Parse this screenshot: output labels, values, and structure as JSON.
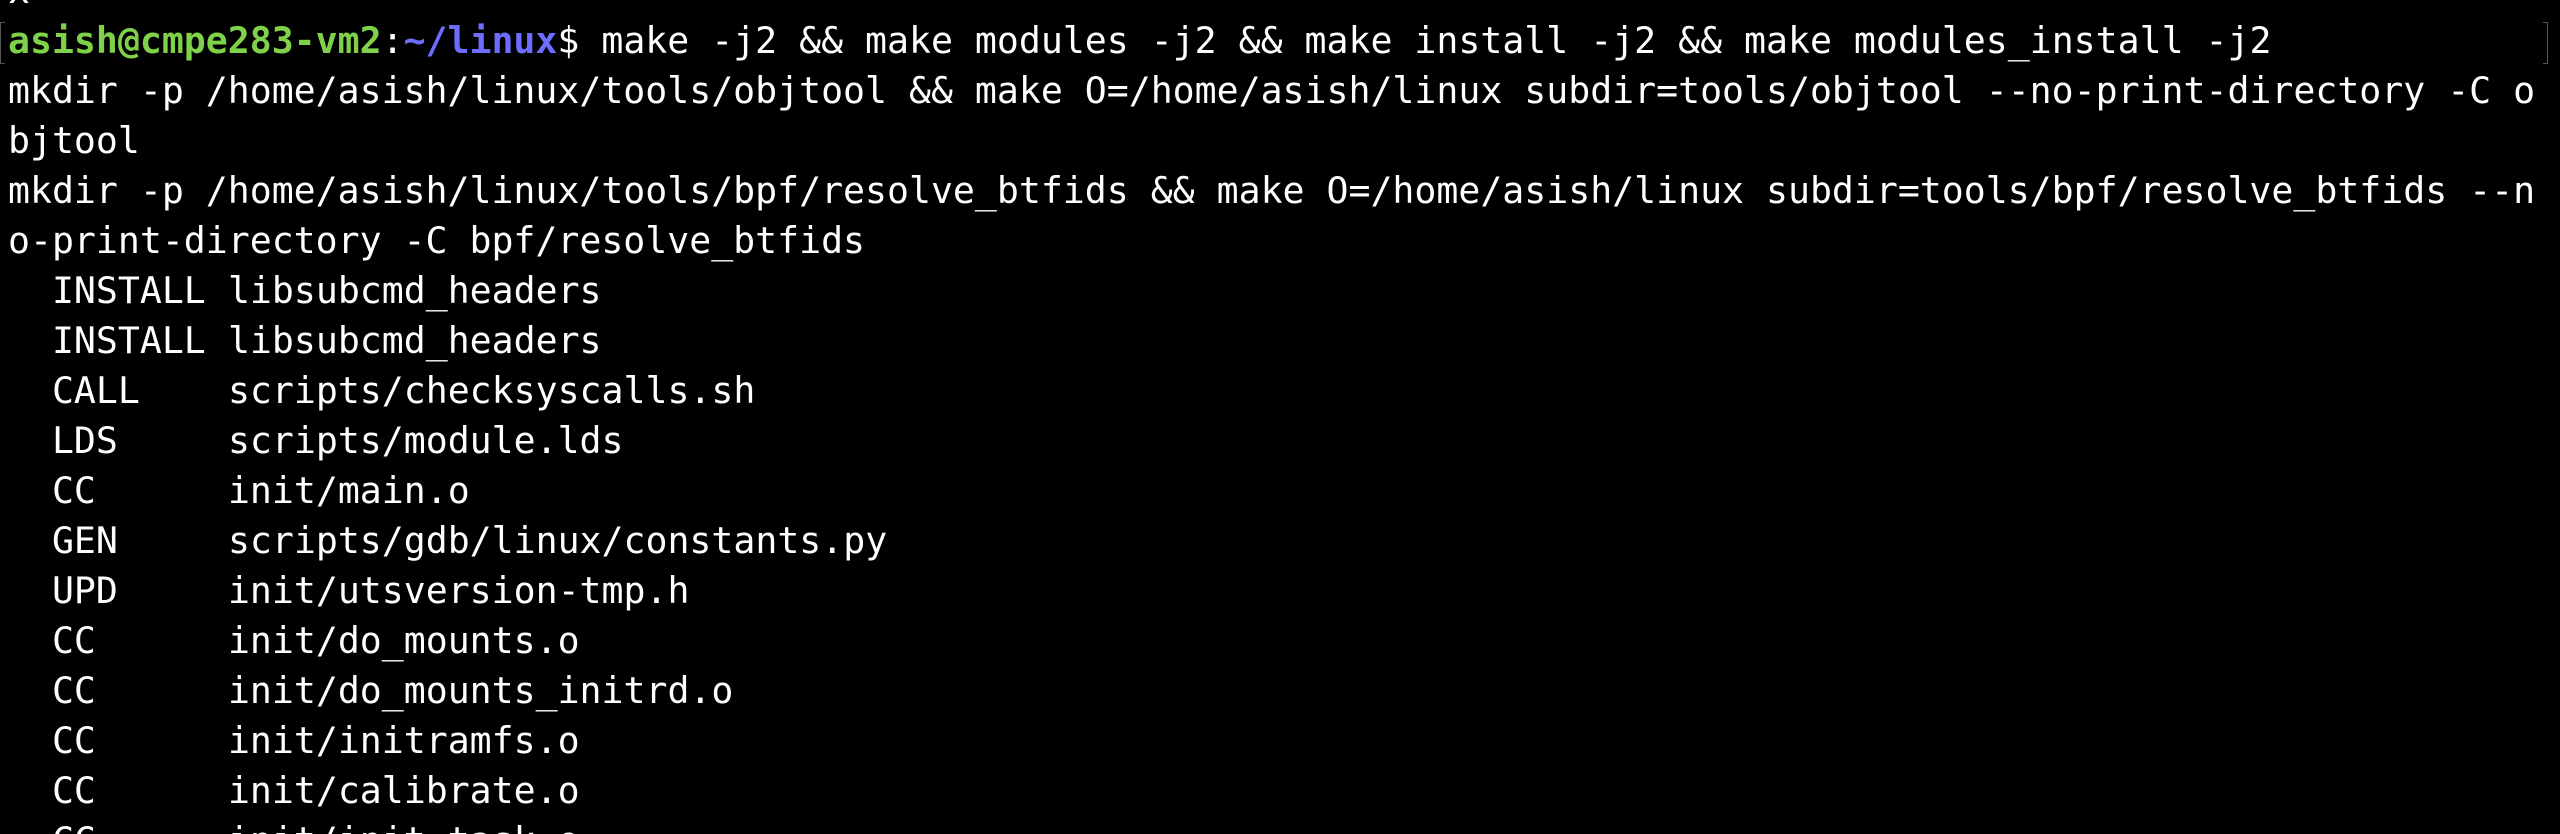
{
  "terminal": {
    "clipped_top_text": "x",
    "prompt": {
      "user_host": "asish@cmpe283-vm2",
      "colon": ":",
      "path": "~/linux",
      "dollar": "$",
      "command": " make -j2 && make modules -j2 && make install -j2 && make modules_install -j2"
    },
    "wrapped_lines": [
      "mkdir -p /home/asish/linux/tools/objtool && make O=/home/asish/linux subdir=tools/objtool --no-print-directory -C o",
      "bjtool",
      "mkdir -p /home/asish/linux/tools/bpf/resolve_btfids && make O=/home/asish/linux subdir=tools/bpf/resolve_btfids --n",
      "o-print-directory -C bpf/resolve_btfids"
    ],
    "build_lines": [
      {
        "tag": "INSTALL",
        "target": "libsubcmd_headers"
      },
      {
        "tag": "INSTALL",
        "target": "libsubcmd_headers"
      },
      {
        "tag": "CALL",
        "target": "scripts/checksyscalls.sh"
      },
      {
        "tag": "LDS",
        "target": "scripts/module.lds"
      },
      {
        "tag": "CC",
        "target": "init/main.o"
      },
      {
        "tag": "GEN",
        "target": "scripts/gdb/linux/constants.py"
      },
      {
        "tag": "UPD",
        "target": "init/utsversion-tmp.h"
      },
      {
        "tag": "CC",
        "target": "init/do_mounts.o"
      },
      {
        "tag": "CC",
        "target": "init/do_mounts_initrd.o"
      },
      {
        "tag": "CC",
        "target": "init/initramfs.o"
      },
      {
        "tag": "CC",
        "target": "init/calibrate.o"
      },
      {
        "tag": "CC",
        "target": "init/init_task.o"
      }
    ],
    "colors": {
      "background": "#000000",
      "text": "#ffffff",
      "user_host": "#7fd14a",
      "path": "#6d6dff"
    }
  }
}
